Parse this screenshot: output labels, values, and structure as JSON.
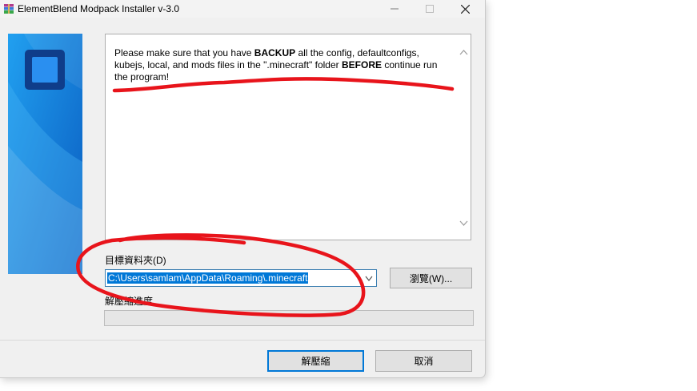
{
  "window": {
    "title": "ElementBlend Modpack Installer v-3.0"
  },
  "titlebar_icons": {
    "app": "winrar-books-icon",
    "minimize": "minimize-icon",
    "maximize": "maximize-icon",
    "close": "close-icon"
  },
  "message": {
    "part1": "Please make sure that you have ",
    "bold1": "BACKUP",
    "part2": " all the config, defaultconfigs, kubejs, local, and mods files in the \".minecraft\" folder ",
    "bold2": "BEFORE",
    "part3": " continue run the program!"
  },
  "destination": {
    "label": "目標資料夾(D)",
    "path": "C:\\Users\\samlam\\AppData\\Roaming\\.minecraft",
    "browse_label": "瀏覽(W)..."
  },
  "progress": {
    "label": "解壓縮進度",
    "value": 0
  },
  "buttons": {
    "extract_label": "解壓縮",
    "cancel_label": "取消"
  },
  "colors": {
    "banner_top": "#1e90e6",
    "banner_bottom": "#0b62c4",
    "selection": "#0078d7",
    "annotation": "#e8141b"
  }
}
